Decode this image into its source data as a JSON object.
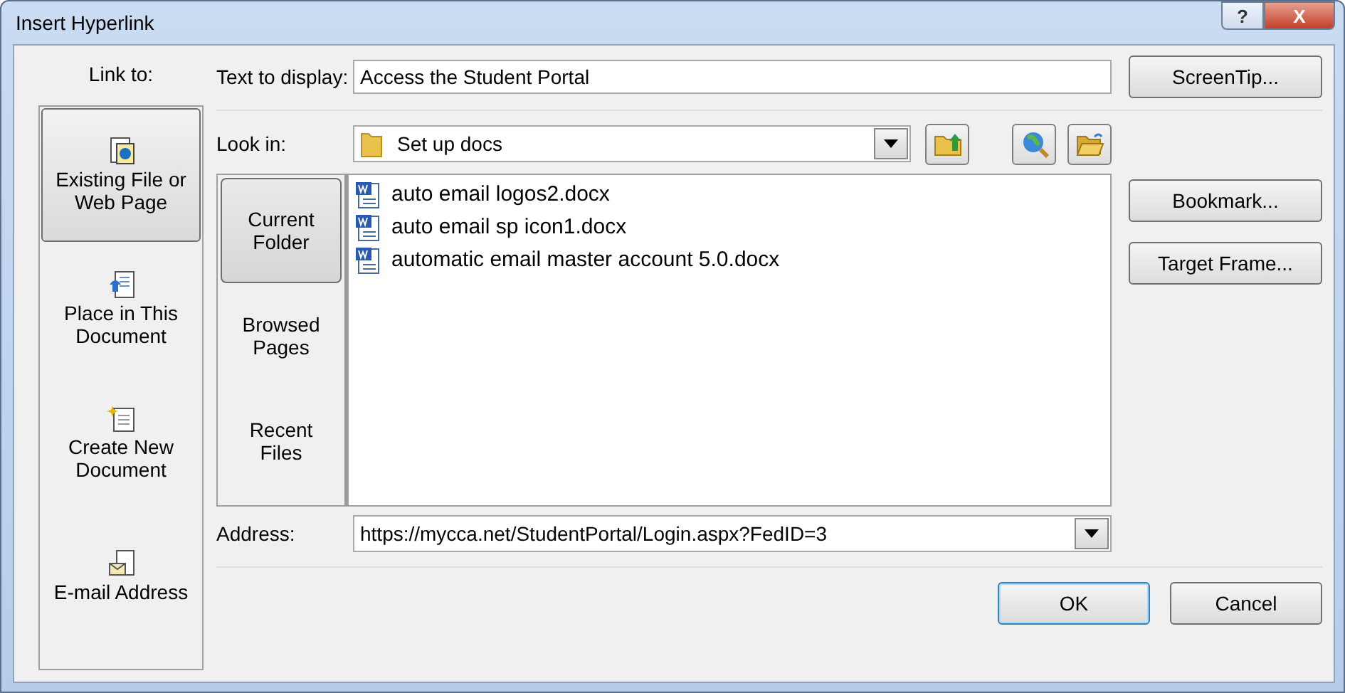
{
  "window": {
    "title": "Insert Hyperlink",
    "help": "?",
    "close": "X"
  },
  "link_to": {
    "label": "Link to:",
    "items": [
      {
        "label": "Existing File or\nWeb Page",
        "kind": "file",
        "selected": true
      },
      {
        "label": "Place in This\nDocument",
        "kind": "place",
        "selected": false
      },
      {
        "label": "Create New\nDocument",
        "kind": "new",
        "selected": false
      },
      {
        "label": "E-mail Address",
        "kind": "email",
        "selected": false
      }
    ]
  },
  "text_to_display": {
    "label": "Text to display:",
    "value": "Access the Student Portal"
  },
  "look_in": {
    "label": "Look in:",
    "value": "Set up docs"
  },
  "browse_tabs": [
    {
      "label": "Current\nFolder",
      "selected": true
    },
    {
      "label": "Browsed\nPages",
      "selected": false
    },
    {
      "label": "Recent\nFiles",
      "selected": false
    }
  ],
  "files": [
    {
      "name": "auto email logos2.docx"
    },
    {
      "name": "auto email sp icon1.docx"
    },
    {
      "name": "automatic email master account 5.0.docx"
    }
  ],
  "side_buttons": [
    "ScreenTip...",
    "Bookmark...",
    "Target Frame..."
  ],
  "address": {
    "label": "Address:",
    "value": "https://mycca.net/StudentPortal/Login.aspx?FedID=3"
  },
  "buttons": [
    {
      "label": "OK",
      "default": true
    },
    {
      "label": "Cancel",
      "default": false
    }
  ]
}
